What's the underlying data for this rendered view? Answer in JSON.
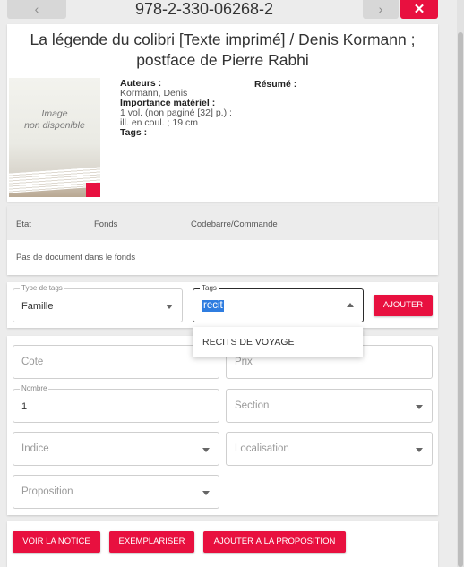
{
  "header": {
    "isbn": "978-2-330-06268-2",
    "prev_icon": "‹",
    "next_icon": "›",
    "close_icon": "✕"
  },
  "notice": {
    "title": "La légende du colibri [Texte imprimé] / Denis Kormann ; postface de Pierre Rabhi",
    "cover_text": "Image\nnon disponible",
    "auteurs_label": "Auteurs :",
    "auteurs_value": "Kormann, Denis",
    "importance_label": "Importance matériel :",
    "importance_value": "1 vol. (non paginé [32] p.) : ill. en coul. ; 19 cm",
    "tags_label": "Tags :",
    "resume_label": "Résumé :"
  },
  "exemplaires": {
    "columns": [
      "Etat",
      "Fonds",
      "Codebarre/Commande"
    ],
    "empty_message": "Pas de document dans le fonds"
  },
  "tags_form": {
    "type_label": "Type de tags",
    "type_value": "Famille",
    "tags_label": "Tags",
    "tags_value": "recit",
    "add_button": "AJOUTER",
    "suggestions": [
      "RECITS DE VOYAGE"
    ]
  },
  "fields": {
    "cote_placeholder": "Cote",
    "prix_placeholder": "Prix",
    "nombre_label": "Nombre",
    "nombre_value": "1",
    "section_placeholder": "Section",
    "indice_placeholder": "Indice",
    "localisation_placeholder": "Localisation",
    "proposition_placeholder": "Proposition"
  },
  "actions": {
    "voir_notice": "VOIR LA NOTICE",
    "exemplariser": "EXEMPLARISER",
    "ajouter_proposition": "AJOUTER À LA PROPOSITION"
  },
  "colors": {
    "accent": "#e8103f",
    "selection": "#2f7de0",
    "background": "#ececec"
  }
}
